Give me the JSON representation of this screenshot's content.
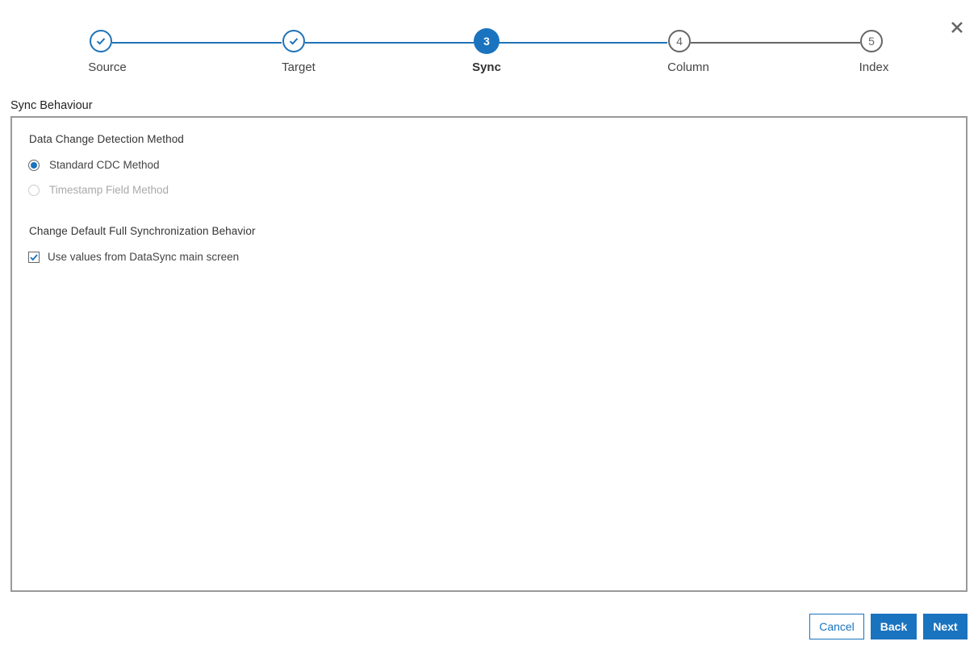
{
  "wizard": {
    "close_icon": "close-icon",
    "steps": [
      {
        "number": "1",
        "label": "Source",
        "state": "completed",
        "icon": "check-icon"
      },
      {
        "number": "2",
        "label": "Target",
        "state": "completed",
        "icon": "check-icon"
      },
      {
        "number": "3",
        "label": "Sync",
        "state": "active"
      },
      {
        "number": "4",
        "label": "Column",
        "state": "pending"
      },
      {
        "number": "5",
        "label": "Index",
        "state": "pending"
      }
    ]
  },
  "section": {
    "title": "Sync Behaviour",
    "detection": {
      "title": "Data Change Detection Method",
      "options": [
        {
          "label": "Standard CDC Method",
          "selected": true,
          "disabled": false
        },
        {
          "label": "Timestamp Field Method",
          "selected": false,
          "disabled": true
        }
      ]
    },
    "full_sync": {
      "title": "Change Default Full Synchronization Behavior",
      "checkbox": {
        "label": "Use values from DataSync main screen",
        "checked": true
      }
    }
  },
  "footer": {
    "cancel_label": "Cancel",
    "back_label": "Back",
    "next_label": "Next"
  },
  "colors": {
    "accent": "#1a73bf",
    "pending": "#666666",
    "disabled": "#aaaaaa"
  }
}
